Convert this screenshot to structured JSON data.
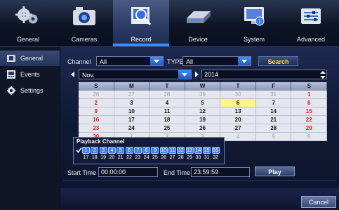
{
  "tabs": [
    {
      "label": "General",
      "icon": "gears-icon",
      "active": false
    },
    {
      "label": "Cameras",
      "icon": "camera-icon",
      "active": false
    },
    {
      "label": "Record",
      "icon": "record-search-icon",
      "active": true
    },
    {
      "label": "Device",
      "icon": "hard-drive-icon",
      "active": false
    },
    {
      "label": "System",
      "icon": "system-monitor-icon",
      "active": false
    },
    {
      "label": "Advanced",
      "icon": "sliders-icon",
      "active": false
    }
  ],
  "sidebar": {
    "items": [
      {
        "label": "General",
        "icon": "film-icon",
        "active": true
      },
      {
        "label": "Events",
        "icon": "events-icon",
        "active": false
      },
      {
        "label": "Settings",
        "icon": "settings-gear-icon",
        "active": false
      }
    ]
  },
  "filter": {
    "channel_label": "Channel",
    "channel_value": "All",
    "type_label": "TYPE",
    "type_value": "All",
    "search_label": "Search"
  },
  "date_nav": {
    "month": "Nov.",
    "year": "2014"
  },
  "calendar": {
    "weekdays": [
      "S",
      "M",
      "T",
      "W",
      "T",
      "F",
      "S"
    ],
    "weeks": [
      [
        "26",
        "27",
        "28",
        "29",
        "30",
        "31",
        "1"
      ],
      [
        "2",
        "3",
        "4",
        "5",
        "6",
        "7",
        "8"
      ],
      [
        "9",
        "10",
        "11",
        "12",
        "13",
        "14",
        "15"
      ],
      [
        "16",
        "17",
        "18",
        "19",
        "20",
        "21",
        "22"
      ],
      [
        "23",
        "24",
        "25",
        "26",
        "27",
        "28",
        "29"
      ],
      [
        "30",
        "1",
        "2",
        "3",
        "4",
        "5",
        "6"
      ]
    ],
    "recorded_day": "6"
  },
  "playback": {
    "title": "Playback Channel",
    "channels": [
      "1",
      "2",
      "3",
      "4",
      "5",
      "6",
      "7",
      "8",
      "9",
      "10",
      "11",
      "12",
      "13",
      "14",
      "15",
      "16",
      "17",
      "18",
      "19",
      "20",
      "21",
      "22",
      "23",
      "24",
      "25",
      "26",
      "27",
      "28",
      "29",
      "30",
      "31",
      "32"
    ]
  },
  "time": {
    "start_label": "Start Time",
    "start_value": "00:00:00",
    "end_label": "End Time",
    "end_value": "23:59:59",
    "play_label": "Play"
  },
  "footer": {
    "cancel_label": "Cancel"
  },
  "colors": {
    "accent": "#3a8df8",
    "search_text": "#ffd84a",
    "weekend_red": "#e01818",
    "record_highlight": "#fff48a"
  }
}
